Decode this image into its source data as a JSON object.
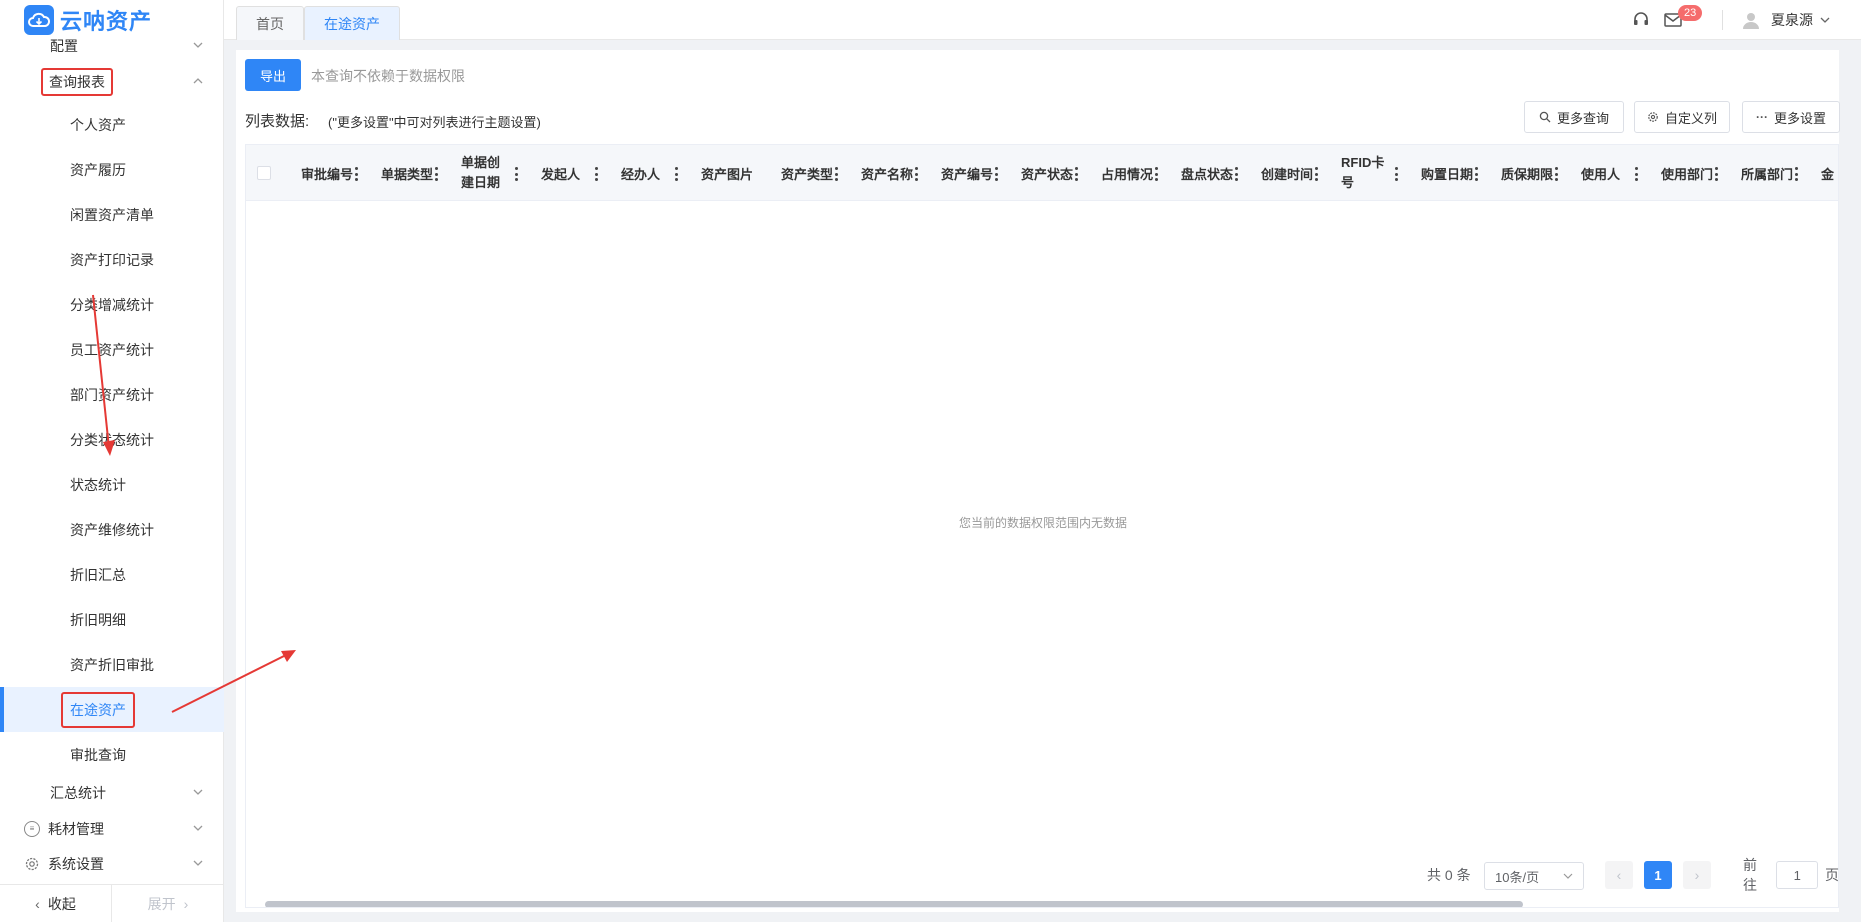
{
  "app": {
    "name": "云呐资产"
  },
  "sidebar": {
    "groups": {
      "config": "配置",
      "report": "查询报表",
      "summary": "汇总统计",
      "consumables": "耗材管理",
      "settings": "系统设置"
    },
    "items": [
      "个人资产",
      "资产履历",
      "闲置资产清单",
      "资产打印记录",
      "分类增减统计",
      "员工资产统计",
      "部门资产统计",
      "分类状态统计",
      "状态统计",
      "资产维修统计",
      "折旧汇总",
      "折旧明细",
      "资产折旧审批",
      "在途资产",
      "审批查询"
    ],
    "collapse": "收起",
    "expand": "展开"
  },
  "tabs": [
    "首页",
    "在途资产"
  ],
  "topbar": {
    "badge": "23",
    "user": "夏泉源"
  },
  "main": {
    "export_button": "导出",
    "hint": "本查询不依赖于数据权限",
    "list_title": "列表数据:",
    "list_note": "(\"更多设置\"中可对列表进行主题设置)",
    "more_query": "更多查询",
    "custom_columns": "自定义列",
    "more_settings": "更多设置",
    "columns": [
      "审批编号",
      "单据类型",
      "单据创建日期",
      "发起人",
      "经办人",
      "资产图片",
      "资产类型",
      "资产名称",
      "资产编号",
      "资产状态",
      "占用情况",
      "盘点状态",
      "创建时间",
      "RFID卡号",
      "购置日期",
      "质保期限",
      "使用人",
      "使用部门",
      "所属部门",
      "金"
    ],
    "empty": "您当前的数据权限范围内无数据"
  },
  "pagination": {
    "total": "共 0 条",
    "page_size": "10条/页",
    "current": "1",
    "goto_label": "前往",
    "goto_value": "1",
    "page_suffix": "页"
  }
}
